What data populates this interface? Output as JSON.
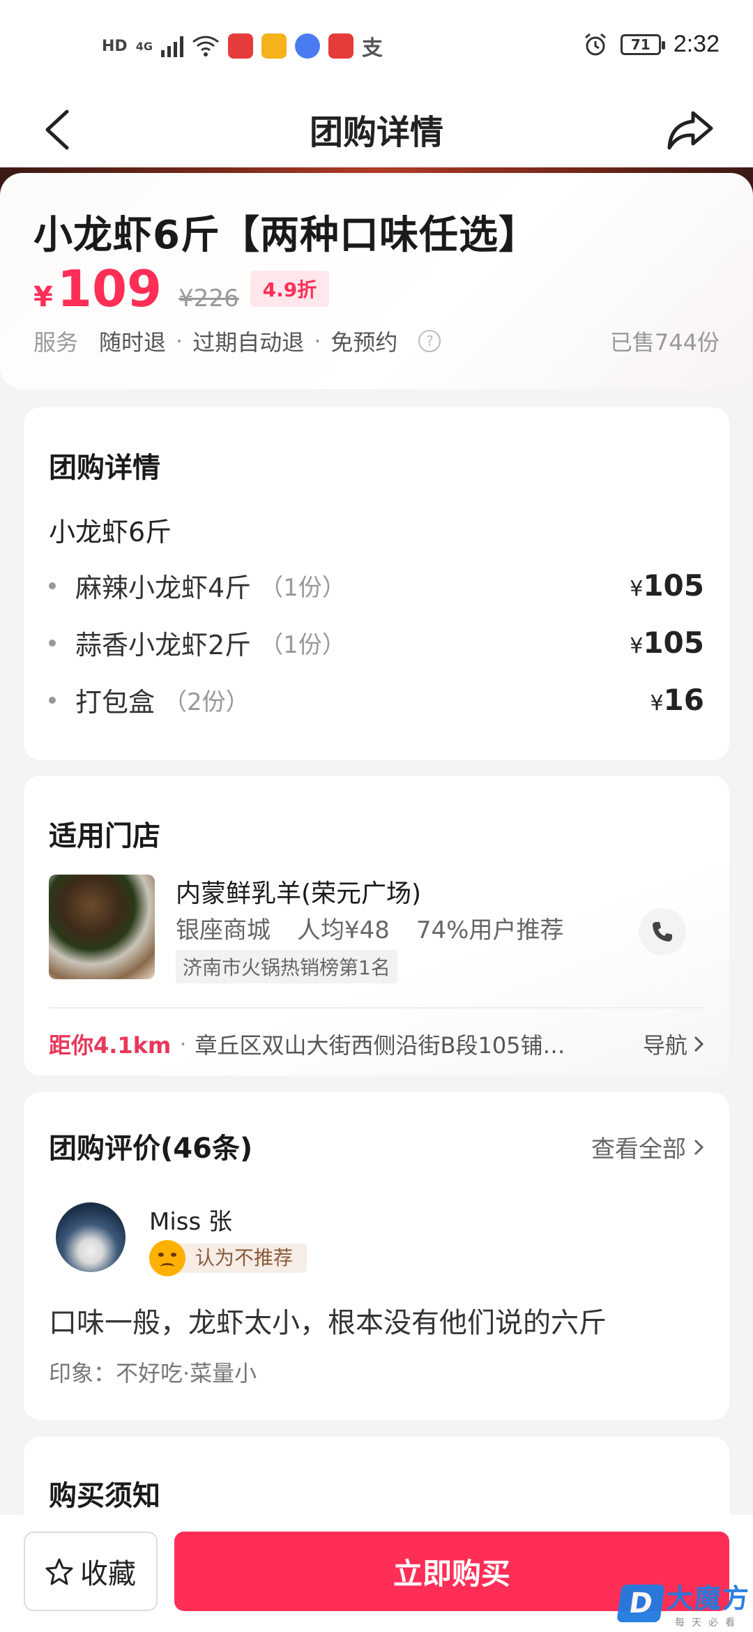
{
  "status_bar": {
    "hd": "HD",
    "net": "4G",
    "time": "2:32",
    "battery": "71"
  },
  "nav": {
    "title": "团购详情"
  },
  "deal": {
    "title": "小龙虾6斤【两种口味任选】",
    "currency": "¥",
    "price": "109",
    "original_price": "¥226",
    "discount": "4.9折",
    "service_label": "服务",
    "services": [
      "随时退",
      "过期自动退",
      "免预约"
    ],
    "sold": "已售744份",
    "accent_color": "#ff2e57"
  },
  "detail": {
    "title": "团购详情",
    "subtitle": "小龙虾6斤",
    "items": [
      {
        "name": "麻辣小龙虾4斤",
        "qty": "（1份）",
        "currency": "¥",
        "price": "105"
      },
      {
        "name": "蒜香小龙虾2斤",
        "qty": "（1份）",
        "currency": "¥",
        "price": "105"
      },
      {
        "name": "打包盒",
        "qty": "（2份）",
        "currency": "¥",
        "price": "16"
      }
    ]
  },
  "store": {
    "title": "适用门店",
    "name": "内蒙鲜乳羊(荣元广场)",
    "area": "银座商城",
    "avg": "人均¥48",
    "recommend": "74%用户推荐",
    "rank": "济南市火锅热销榜第1名",
    "distance": "距你4.1km",
    "address": "章丘区双山大街西侧沿街B段105铺…",
    "nav_label": "导航"
  },
  "reviews": {
    "title": "团购评价(46条)",
    "view_all": "查看全部",
    "reviewer": "Miss 张",
    "tag": "认为不推荐",
    "text": "口味一般，龙虾太小，根本没有他们说的六斤",
    "impression": "印象：不好吃·菜量小"
  },
  "notice": {
    "title": "购买须知"
  },
  "bottom": {
    "favorite": "收藏",
    "buy": "立即购买"
  },
  "watermark": {
    "logo": "D",
    "name": "大魔方",
    "slogan": "每天必看"
  }
}
